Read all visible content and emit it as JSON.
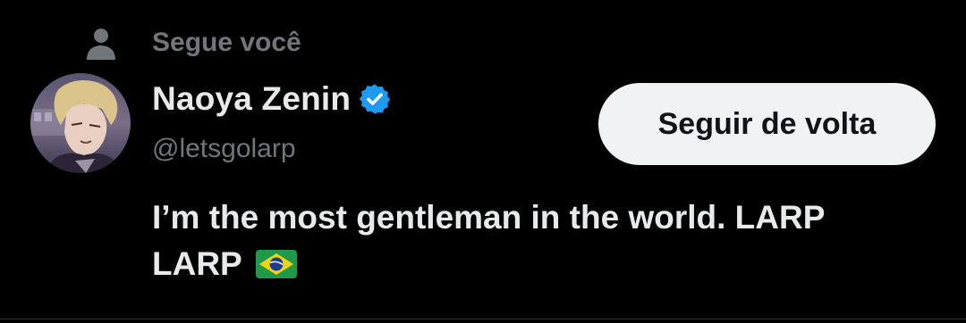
{
  "follows_you": {
    "label": "Segue você",
    "icon": "person-icon"
  },
  "profile": {
    "display_name": "Naoya Zenin",
    "verified": true,
    "verified_icon": "verified-badge-icon",
    "handle": "@letsgolarp",
    "avatar_icon": "avatar",
    "bio_line1": "I’m the most gentleman in the world. LARP",
    "bio_line2": "LARP",
    "bio_flag_icon": "brazil-flag-icon"
  },
  "actions": {
    "follow_back_label": "Seguir de volta"
  },
  "colors": {
    "background": "#000000",
    "primary_text": "#e7e9ea",
    "secondary_text": "#71767b",
    "verified_blue": "#1d9bf0",
    "button_bg": "#eff3f4",
    "button_text": "#0f1419"
  }
}
